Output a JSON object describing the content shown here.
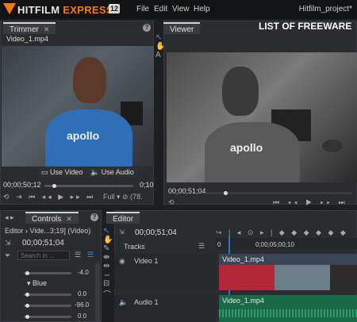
{
  "app": {
    "brand_main": "HITFILM",
    "brand_accent": "EXPRESS",
    "version": "12",
    "project": "Hitfilm_project*"
  },
  "menu": [
    "File",
    "Edit",
    "View",
    "Help"
  ],
  "trimmer": {
    "tab": "Trimmer",
    "file": "Video_1.mp4",
    "timecode": "00;00;50;12",
    "timecode_right": "0;10",
    "use_video": "Use Video",
    "use_audio": "Use Audio",
    "zoom": "Full",
    "zoom_value": "(78."
  },
  "viewer": {
    "tab": "Viewer",
    "overlay": "LIST OF FREEWARE",
    "timecode": "00;00;51;04"
  },
  "controls": {
    "tab": "Controls",
    "editor_line": "Editor › Vide...3;19] (Video)",
    "timecode": "00;00;51;04",
    "search_placeholder": "Search in ...",
    "values": [
      "-4.0",
      "0.0",
      "-96.0",
      "0.0"
    ],
    "group": "Blue"
  },
  "editor": {
    "tab": "Editor",
    "timecode": "00;00;51;04",
    "tracks_label": "Tracks",
    "ruler": [
      "0",
      "0;00;05;00;10"
    ],
    "video_track": "Video 1",
    "audio_track": "Audio 1",
    "video_clip": "Video_1.mp4",
    "audio_clip": "Video_1.mp4"
  },
  "colors": {
    "accent": "#f07b1a",
    "playhead": "#2e74d6",
    "video_clip": "#b32738",
    "audio_clip": "#1a6a4a"
  }
}
